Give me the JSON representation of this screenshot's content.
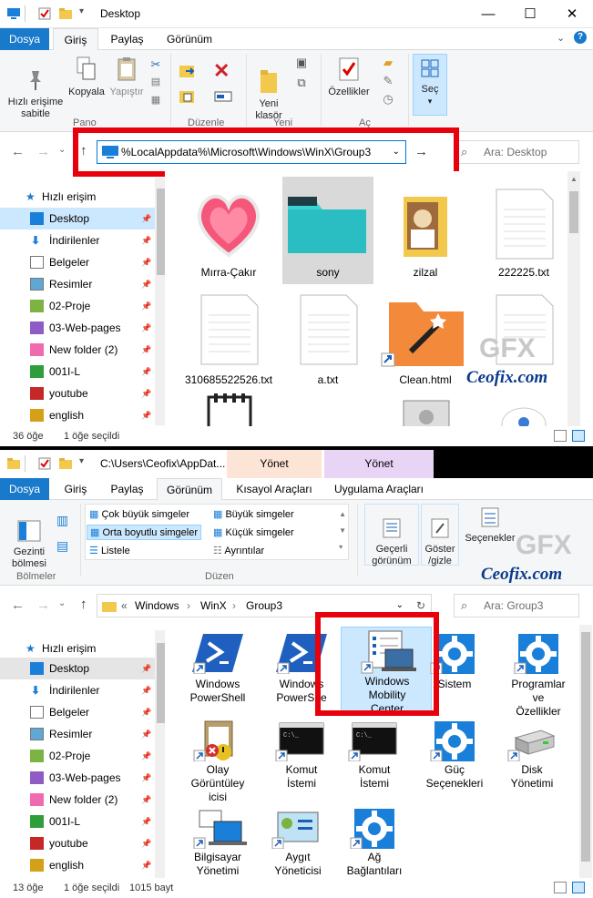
{
  "w1": {
    "title": "Desktop",
    "menu": [
      "Dosya",
      "Giriş",
      "Paylaş",
      "Görünüm"
    ],
    "ribbon": {
      "pin": "Hızlı erişime\nsabitle",
      "copy": "Kopyala",
      "paste": "Yapıştır",
      "new_folder": "Yeni\nklasör",
      "properties": "Özellikler",
      "select": "Seç",
      "groups": [
        "Pano",
        "Düzenle",
        "Yeni",
        "Aç"
      ]
    },
    "address": "%LocalAppdata%\\Microsoft\\Windows\\WinX\\Group3",
    "search_placeholder": "Ara: Desktop",
    "nav": [
      "Hızlı erişim",
      "Desktop",
      "İndirilenler",
      "Belgeler",
      "Resimler",
      "02-Proje",
      "03-Web-pages",
      "New folder (2)",
      "001I-L",
      "youtube",
      "english"
    ],
    "files": [
      "Mırra-Çakır",
      "sony",
      "zilzal",
      "222225.txt",
      "310685522526.txt",
      "a.txt",
      "Clean.html"
    ],
    "status": {
      "count": "36 öğe",
      "selected": "1 öğe seçildi"
    }
  },
  "w2": {
    "title": "C:\\Users\\Ceofix\\AppDat...",
    "ctx_tabs": [
      {
        "top": "Yönet",
        "bottom": "Kısayol Araçları",
        "color": "#fce4d6"
      },
      {
        "top": "Yönet",
        "bottom": "Uygulama Araçları",
        "color": "#e8d5f5"
      }
    ],
    "menu": [
      "Dosya",
      "Giriş",
      "Paylaş",
      "Görünüm"
    ],
    "ribbon": {
      "nav_pane": "Gezinti\nbölmesi",
      "layout": [
        "Çok büyük simgeler",
        "Büyük simgeler",
        "Orta boyutlu simgeler",
        "Küçük simgeler",
        "Listele",
        "Ayrıntılar"
      ],
      "current_view": "Geçerli\ngörünüm",
      "show_hide": "Göster\n/gizle",
      "options": "Seçenekler",
      "groups": [
        "Bölmeler",
        "Düzen"
      ]
    },
    "breadcrumb": [
      "Windows",
      "WinX",
      "Group3"
    ],
    "search_placeholder": "Ara: Group3",
    "nav": [
      "Hızlı erişim",
      "Desktop",
      "İndirilenler",
      "Belgeler",
      "Resimler",
      "02-Proje",
      "03-Web-pages",
      "New folder (2)",
      "001I-L",
      "youtube",
      "english"
    ],
    "files": [
      "Windows\nPowerShell",
      "Windows\nPowerShe",
      "Windows\nMobility\nCenter",
      "Sistem",
      "Programlar\nve\nÖzellikler",
      "Olay\nGörüntüley\nicisi",
      "Komut\nİstemi",
      "Komut\nİstemi",
      "Güç\nSeçenekleri",
      "Disk\nYönetimi",
      "Bilgisayar\nYönetimi",
      "Aygıt\nYöneticisi",
      "Ağ\nBağlantıları"
    ],
    "status": {
      "count": "13 öğe",
      "selected": "1 öğe seçildi",
      "size": "1015 bayt"
    }
  },
  "watermark": "Ceofix.com",
  "watermark_logo": "GFX",
  "colors": {
    "accent": "#1979ca",
    "highlight": "#cce8ff",
    "redbox": "#e8000c"
  }
}
